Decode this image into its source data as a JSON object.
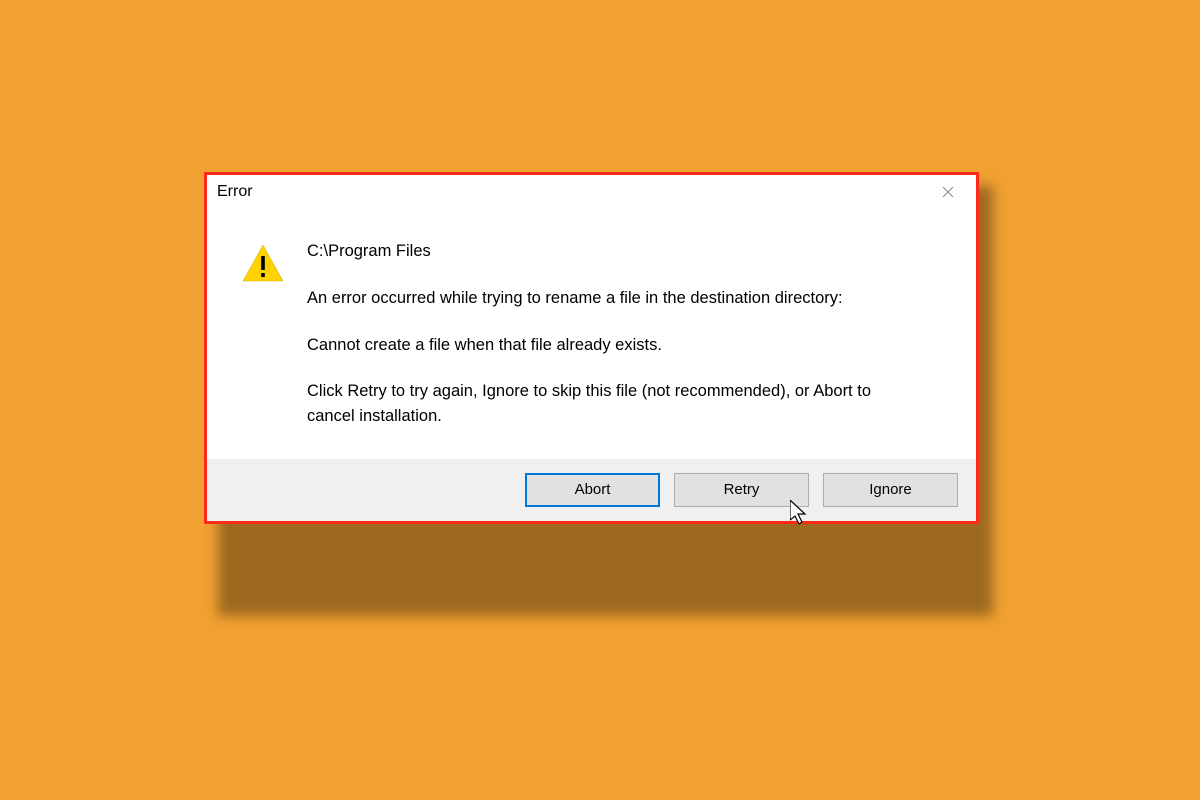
{
  "dialog": {
    "title": "Error",
    "path": "C:\\Program Files",
    "message_intro": "An error occurred while trying to rename a file in the destination directory:",
    "message_error": "Cannot create a file when that file already exists.",
    "message_instruction": "Click Retry to try again, Ignore to skip this file (not recommended), or Abort to cancel installation.",
    "buttons": {
      "abort": "Abort",
      "retry": "Retry",
      "ignore": "Ignore"
    }
  }
}
